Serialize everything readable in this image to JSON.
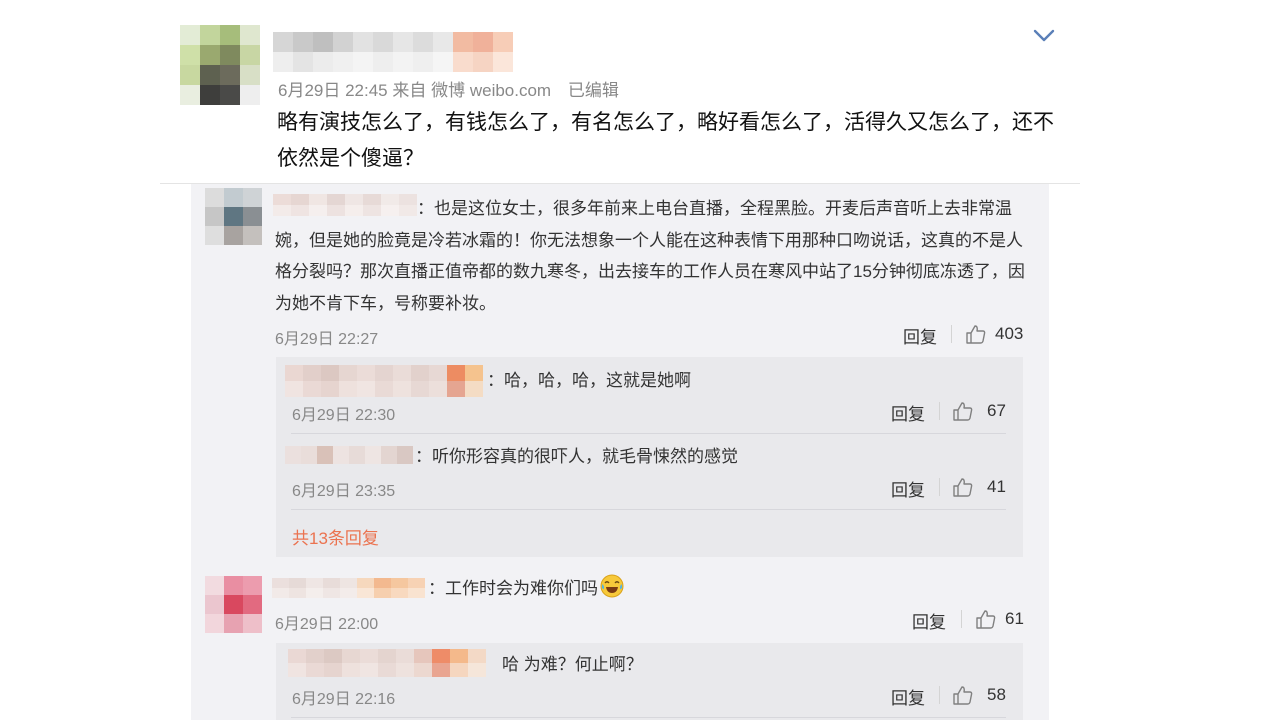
{
  "post": {
    "meta_time": "6月29日 22:45",
    "meta_from": "来自",
    "meta_source": "微博 weibo.com",
    "meta_edited": "已编辑",
    "text": "略有演技怎么了，有钱怎么了，有名怎么了，略好看怎么了，活得久又怎么了，还不依然是个傻逼？",
    "expand_icon": "chevron-down-icon"
  },
  "comments": [
    {
      "text": "：也是这位女士，很多年前来上电台直播，全程黑脸。开麦后声音听上去非常温婉，但是她的脸竟是冷若冰霜的！你无法想象一个人能在这种表情下用那种口吻说话，这真的不是人格分裂吗？那次直播正值帝都的数九寒冬，出去接车的工作人员在寒风中站了15分钟彻底冻透了，因为她不肯下车，号称要补妆。",
      "time": "6月29日 22:27",
      "reply_label": "回复",
      "likes": "403",
      "replies": [
        {
          "text": "：哈，哈，哈，这就是她啊",
          "time": "6月29日 22:30",
          "reply_label": "回复",
          "likes": "67"
        },
        {
          "text": "：听你形容真的很吓人，就毛骨悚然的感觉",
          "time": "6月29日 23:35",
          "reply_label": "回复",
          "likes": "41"
        }
      ],
      "more_replies": "共13条回复"
    },
    {
      "text": "：工作时会为难你们吗",
      "emoji": "laughing-tears-emoji",
      "time": "6月29日 22:00",
      "reply_label": "回复",
      "likes": "61",
      "replies": [
        {
          "text": "哈 为难？何止啊？",
          "time": "6月29日 22:16",
          "reply_label": "回复",
          "likes": "58"
        }
      ]
    }
  ],
  "colors": {
    "accent_link": "#eb7350",
    "comment_bg": "#f2f2f5",
    "reply_bg": "#e9e9ec",
    "meta_text": "#888888"
  }
}
